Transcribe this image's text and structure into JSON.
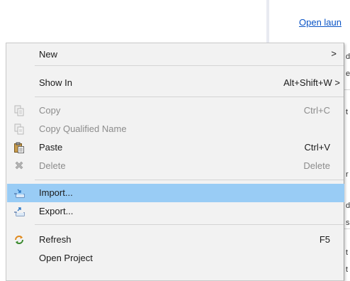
{
  "background": {
    "top_link": "Open laun",
    "right_strip_glyphs": [
      "d",
      "e",
      "t",
      "r",
      "d",
      "s",
      "t",
      "t"
    ]
  },
  "context_menu": {
    "new": {
      "label": "New",
      "submenu_arrow": ">"
    },
    "show_in": {
      "label": "Show In",
      "shortcut": "Alt+Shift+W",
      "submenu_arrow": ">"
    },
    "copy": {
      "label": "Copy",
      "shortcut": "Ctrl+C"
    },
    "copy_qualified_name": {
      "label": "Copy Qualified Name"
    },
    "paste": {
      "label": "Paste",
      "shortcut": "Ctrl+V"
    },
    "delete": {
      "label": "Delete",
      "shortcut": "Delete"
    },
    "import": {
      "label": "Import..."
    },
    "export": {
      "label": "Export..."
    },
    "refresh": {
      "label": "Refresh",
      "shortcut": "F5"
    },
    "open_project": {
      "label": "Open Project"
    }
  },
  "colors": {
    "menu_background": "#f2f2f2",
    "highlight": "#99ccf5",
    "disabled_text": "#8c8c8c",
    "link": "#0a54c6"
  },
  "icons": {
    "copy": "copy-icon",
    "copy_qualified_name": "copy-qualified-name-icon",
    "paste": "paste-icon",
    "delete": "delete-icon",
    "import": "import-icon",
    "export": "export-icon",
    "refresh": "refresh-icon"
  }
}
